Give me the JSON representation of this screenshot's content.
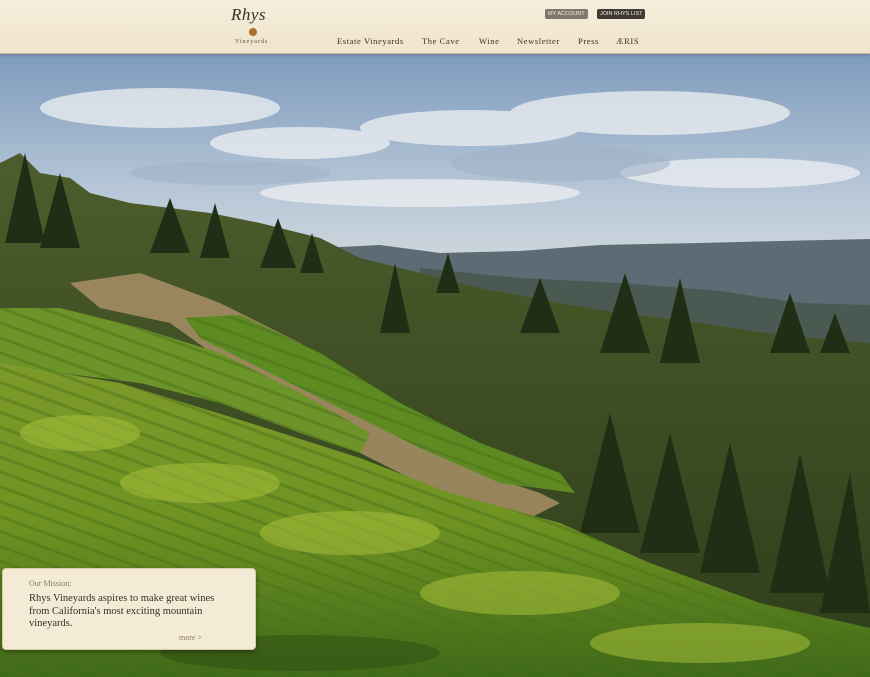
{
  "header": {
    "logo": {
      "name": "Rhys",
      "sub": "Vineyards"
    },
    "utility": {
      "account": "MY ACCOUNT",
      "join": "JOIN RHYS LIST"
    },
    "nav": [
      "Estate Vineyards",
      "The Cave",
      "Wine",
      "Newsletter",
      "Press",
      "ÆRIS"
    ]
  },
  "hero": {
    "alt_subject": "vineyard-hillside-photo"
  },
  "mission": {
    "label": "Our Mission:",
    "text": "Rhys Vineyards aspires to make great wines from California's most exciting mountain vineyards.",
    "more": "more >"
  },
  "colors": {
    "header_bg": "#f4ecd8",
    "accent_dot": "#a9712f",
    "card_bg": "#f4ebd6",
    "text_dark": "#3a2d22"
  }
}
